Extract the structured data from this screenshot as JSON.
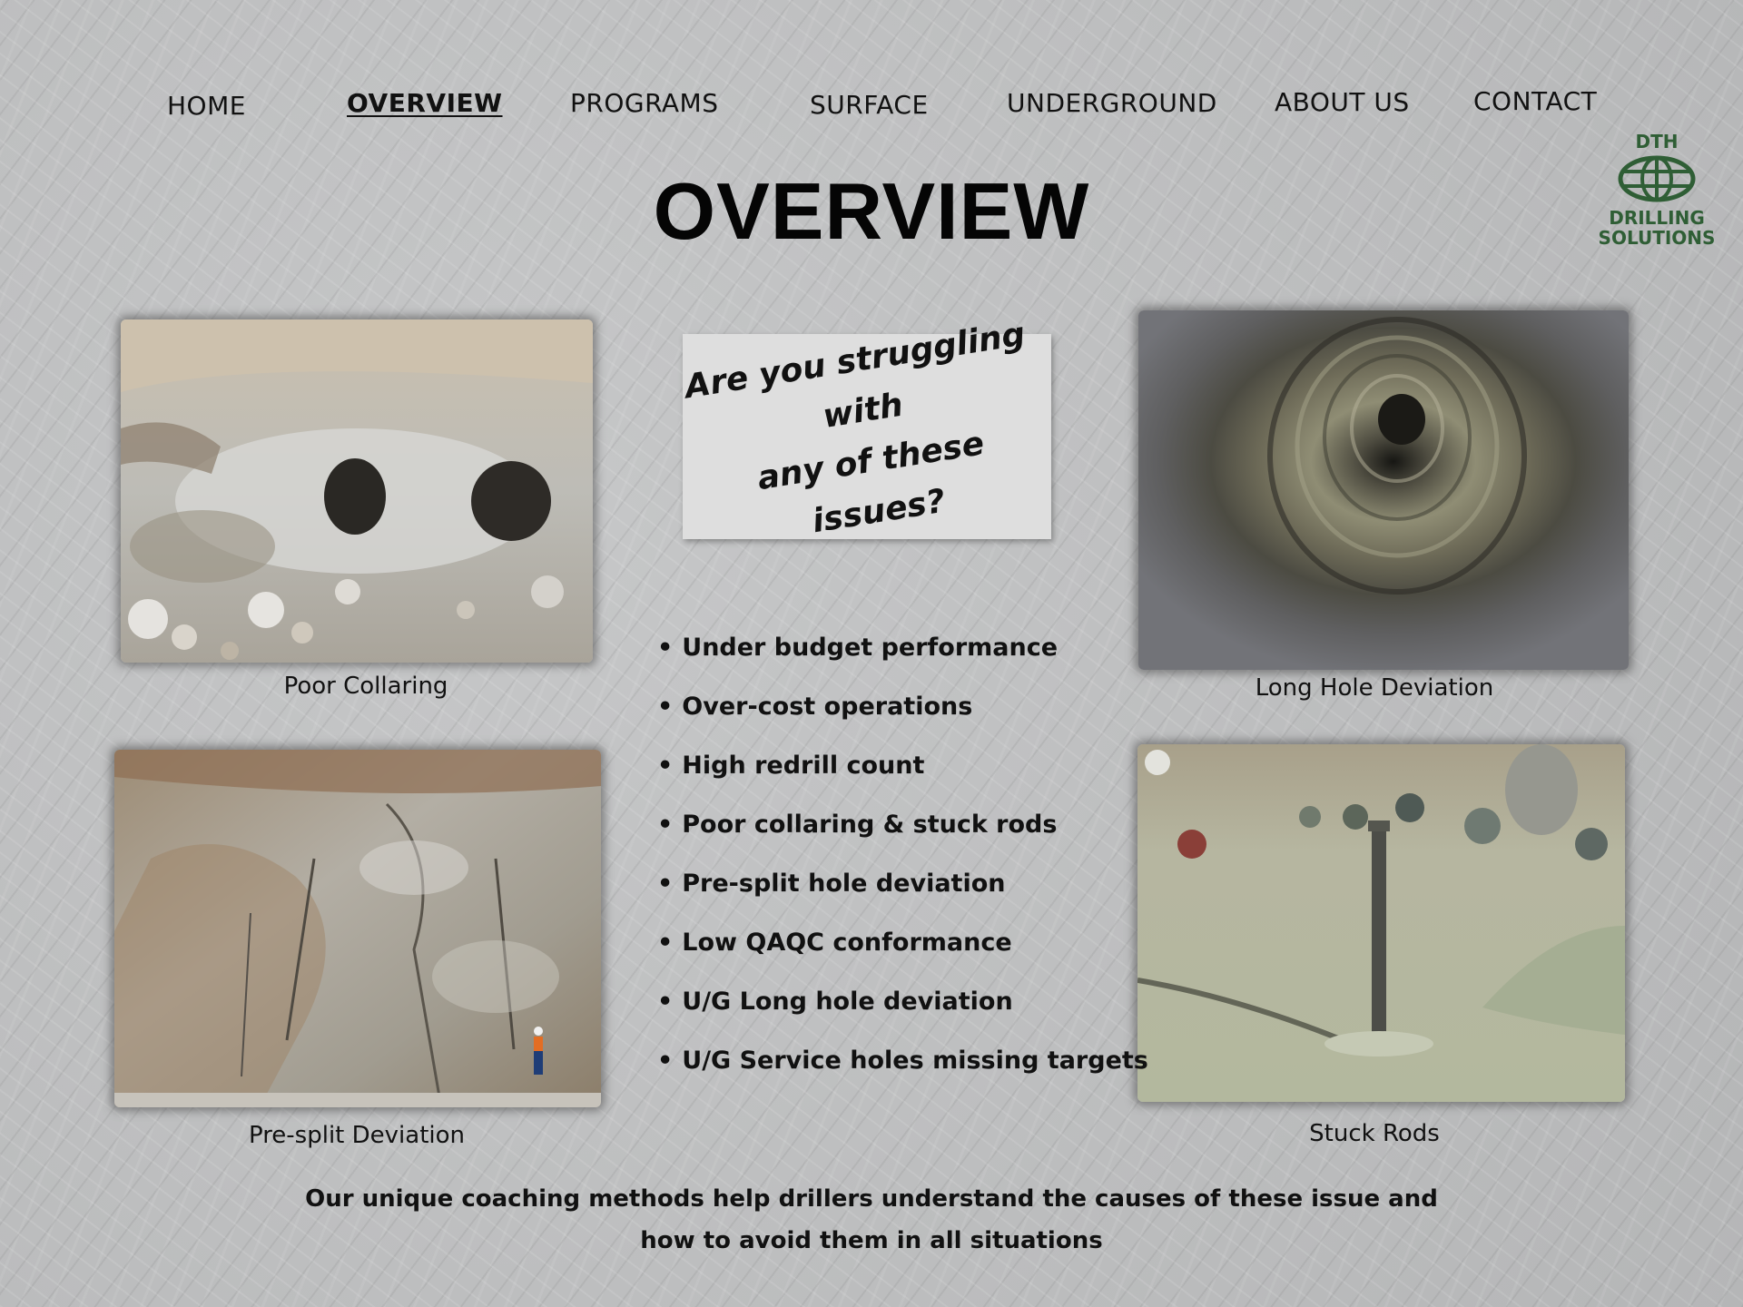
{
  "nav": {
    "items": [
      {
        "label": "HOME"
      },
      {
        "label": "OVERVIEW",
        "active": true
      },
      {
        "label": "PROGRAMS"
      },
      {
        "label": "SURFACE"
      },
      {
        "label": "UNDERGROUND"
      },
      {
        "label": "ABOUT US"
      },
      {
        "label": "CONTACT"
      }
    ]
  },
  "header": {
    "title": "OVERVIEW"
  },
  "logo": {
    "line1": "DTH",
    "line2": "DRILLING",
    "line3": "SOLUTIONS",
    "color": "#2f5e35"
  },
  "callout": {
    "text": "Are you struggling with\nany of these issues?"
  },
  "photos": [
    {
      "caption": "Poor Collaring"
    },
    {
      "caption": "Long Hole Deviation"
    },
    {
      "caption": "Pre-split Deviation"
    },
    {
      "caption": "Stuck Rods"
    }
  ],
  "issues": [
    "Under budget performance",
    "Over-cost operations",
    "High redrill count",
    "Poor collaring & stuck rods",
    "Pre-split hole deviation",
    "Low QAQC conformance",
    "U/G Long hole deviation",
    "U/G Service holes missing targets"
  ],
  "footer": {
    "line1": "Our unique coaching methods help drillers understand the causes of these issue and",
    "line2": "how to avoid them in all situations"
  }
}
